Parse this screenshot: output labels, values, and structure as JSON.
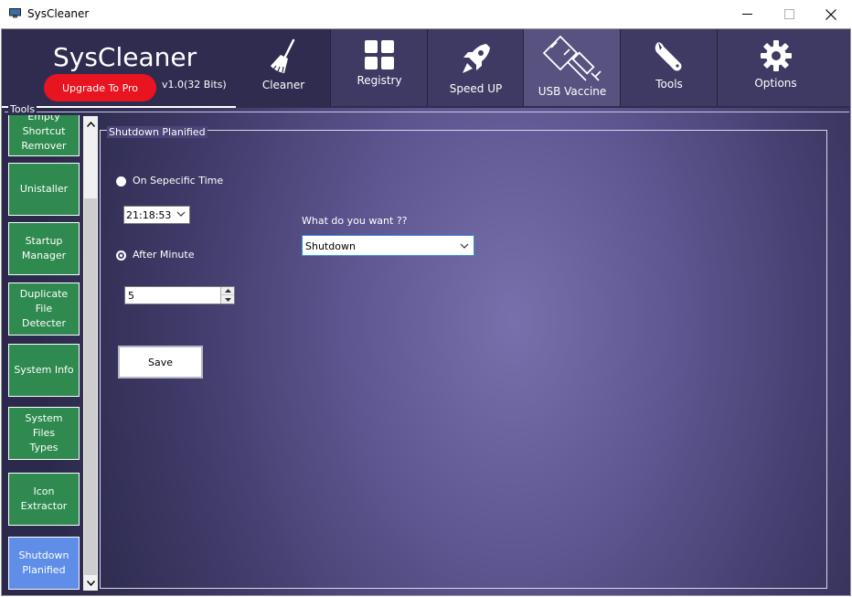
{
  "window": {
    "title": "SysCleaner"
  },
  "header": {
    "brand": "SysCleaner",
    "upgrade_label": "Upgrade To Pro",
    "version": "v1.0(32 Bits)"
  },
  "nav": [
    {
      "label": "Cleaner",
      "icon": "broom-icon"
    },
    {
      "label": "Registry",
      "icon": "grid-icon"
    },
    {
      "label": "Speed UP",
      "icon": "rocket-icon"
    },
    {
      "label": "USB Vaccine",
      "icon": "usb-syringe-icon"
    },
    {
      "label": "Tools",
      "icon": "wrench-icon"
    },
    {
      "label": "Options",
      "icon": "gear-icon"
    }
  ],
  "tools": {
    "caption": "Tools",
    "items": [
      {
        "label": "Empty Shortcut Remover"
      },
      {
        "label": "Unistaller"
      },
      {
        "label": "Startup Manager"
      },
      {
        "label": "Duplicate File Detecter"
      },
      {
        "label": "System Info"
      },
      {
        "label": "System Files Types"
      },
      {
        "label": "Icon Extractor"
      },
      {
        "label": "Shutdown Planified",
        "active": true
      }
    ]
  },
  "shutdown": {
    "caption": "Shutdown Planified",
    "option_specific_time": "On Sepecific Time",
    "time_value": "21:18:53",
    "option_after_minute": "After Minute",
    "minutes_value": "5",
    "want_label": "What do you want ??",
    "action_value": "Shutdown",
    "save_label": "Save"
  },
  "colors": {
    "tool_tile": "#2e8a4e",
    "tool_tile_active": "#5f8ee8",
    "upgrade_button": "#e8141f",
    "header_bg": "#2f2c4f"
  }
}
